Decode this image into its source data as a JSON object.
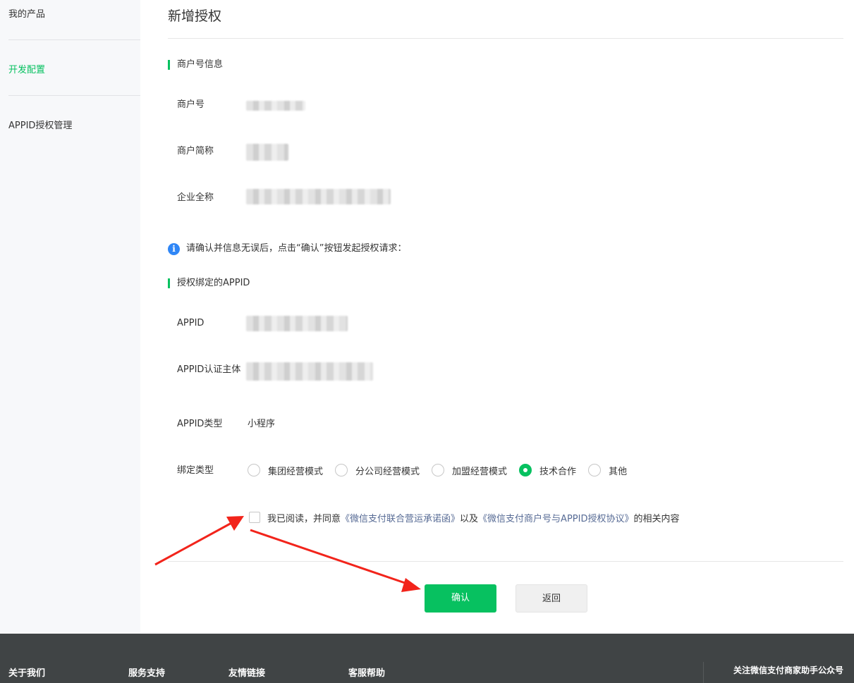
{
  "sidebar": {
    "items": [
      {
        "label": "我的产品",
        "active": false
      },
      {
        "label": "开发配置",
        "active": true
      },
      {
        "label": "APPID授权管理",
        "active": false
      }
    ]
  },
  "page": {
    "title": "新增授权"
  },
  "merchant_section": {
    "title": "商户号信息",
    "fields": [
      {
        "label": "商户号",
        "value_obscured": true
      },
      {
        "label": "商户简称",
        "value_obscured": true
      },
      {
        "label": "企业全称",
        "value_obscured": true
      }
    ]
  },
  "notice": {
    "icon": "info-icon",
    "text": "请确认并信息无误后，点击“确认”按钮发起授权请求："
  },
  "appid_section": {
    "title": "授权绑定的APPID",
    "fields": [
      {
        "label": "APPID",
        "value_obscured": true
      },
      {
        "label": "APPID认证主体",
        "value_obscured": true
      },
      {
        "label": "APPID类型",
        "value": "小程序"
      }
    ],
    "bind_type": {
      "label": "绑定类型",
      "options": [
        "集团经营模式",
        "分公司经营模式",
        "加盟经营模式",
        "技术合作",
        "其他"
      ],
      "selected": "技术合作"
    }
  },
  "agreement": {
    "checked": false,
    "prefix": "我已阅读，并同意",
    "link1": "《微信支付联合营运承诺函》",
    "middle": "以及",
    "link2": "《微信支付商户号与APPID授权协议》",
    "suffix": "的相关内容"
  },
  "buttons": {
    "confirm": "确认",
    "back": "返回"
  },
  "footer": {
    "columns": [
      "关于我们",
      "服务支持",
      "友情链接",
      "客服帮助"
    ],
    "right_text": "关注微信支付商家助手公众号"
  },
  "colors": {
    "accent": "#07c160",
    "link": "#576b95",
    "info": "#2f86f6",
    "annotation_arrow": "#f2241b",
    "footer_bg": "#404445"
  }
}
